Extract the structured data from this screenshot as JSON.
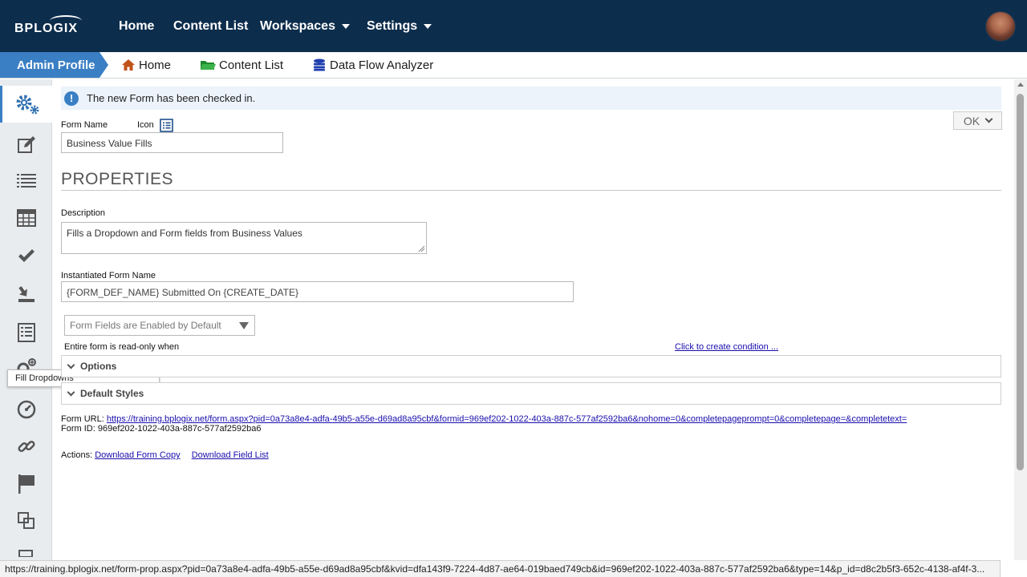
{
  "topbar": {
    "logo_text": "BPLOGIX",
    "nav": [
      {
        "label": "Home"
      },
      {
        "label": "Content List"
      },
      {
        "label": "Workspaces"
      },
      {
        "label": "Settings"
      }
    ]
  },
  "subbar": {
    "admin_profile": "Admin Profile",
    "crumbs": [
      {
        "label": "Home",
        "icon": "home-icon"
      },
      {
        "label": "Content List",
        "icon": "folder-icon"
      },
      {
        "label": "Data Flow Analyzer",
        "icon": "database-icon"
      }
    ]
  },
  "rail": {
    "icons": [
      "gears-icon",
      "edit-icon",
      "list-icon",
      "table-icon",
      "check-icon",
      "download-icon",
      "form-list-icon",
      "add-gear-icon",
      "dashboard-icon",
      "link-icon",
      "flag-icon",
      "copy-icon"
    ],
    "tooltip": "Fill Dropdowns"
  },
  "notice": {
    "text": "The new Form has been checked in."
  },
  "ok_button": "OK",
  "form": {
    "name_label": "Form Name",
    "icon_label": "Icon",
    "name_value": "Business Value Fills"
  },
  "properties": {
    "title": "PROPERTIES",
    "description_label": "Description",
    "description_value": "Fills a Dropdown and Form fields from Business Values",
    "instantiated_label": "Instantiated Form Name",
    "instantiated_value": "{FORM_DEF_NAME} Submitted On {CREATE_DATE}",
    "fields_select": "Form Fields are Enabled by Default",
    "readonly_label": "Entire form is read-only when",
    "condition_link": "Click to create condition ...",
    "options_label": "Options",
    "default_styles_label": "Default Styles"
  },
  "meta": {
    "url_label": "Form URL:",
    "url_value": "https://training.bplogix.net/form.aspx?pid=0a73a8e4-adfa-49b5-a55e-d69ad8a95cbf&formid=969ef202-1022-403a-887c-577af2592ba6&nohome=0&completepageprompt=0&completepage=&completetext=",
    "id_label": "Form ID:",
    "id_value": "969ef202-1022-403a-887c-577af2592ba6",
    "actions_label": "Actions:",
    "download_copy": "Download Form Copy",
    "download_fields": "Download Field List"
  },
  "statusbar": {
    "text": "https://training.bplogix.net/form-prop.aspx?pid=0a73a8e4-adfa-49b5-a55e-d69ad8a95cbf&kvid=dfa143f9-7224-4d87-ae64-019baed749cb&id=969ef202-1022-403a-887c-577af2592ba6&type=14&p_id=d8c2b5f3-652c-4138-af4f-3..."
  },
  "colors": {
    "topbar": "#0d2d4c",
    "accent": "#3a7fc4",
    "link": "#1a0dab"
  }
}
